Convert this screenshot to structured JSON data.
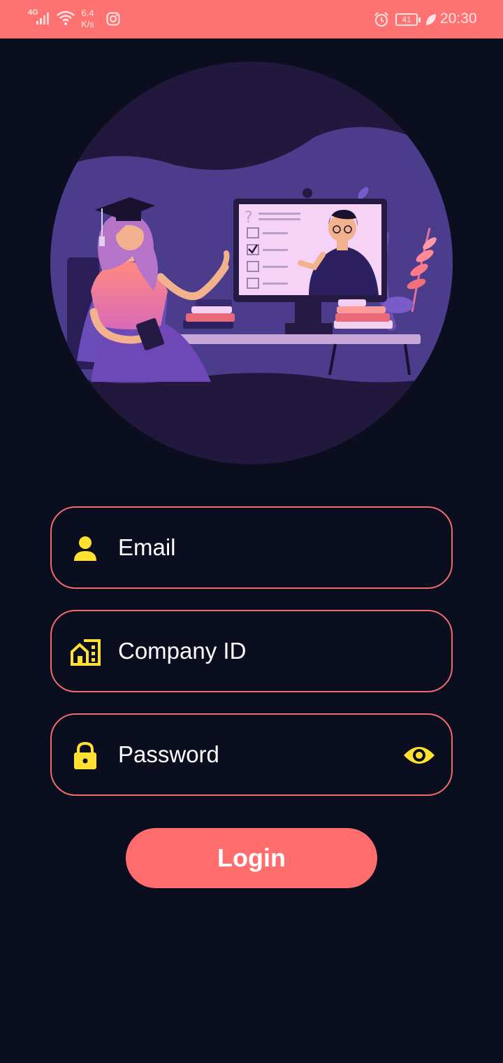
{
  "status_bar": {
    "network": "4G",
    "speed_value": "6.4",
    "speed_unit": "K/s",
    "battery": "41",
    "time": "20:30",
    "icons": [
      "signal-icon",
      "wifi-icon",
      "instagram-icon",
      "alarm-icon",
      "battery-icon",
      "leaf-icon"
    ]
  },
  "illustration": {
    "description_icon": "online-learning-illustration"
  },
  "form": {
    "email_label": "Email",
    "company_label": "Company ID",
    "password_label": "Password",
    "login_label": "Login"
  },
  "colors": {
    "accent": "#ff6d6d",
    "background": "#0a0e1e",
    "icon": "#ffe033",
    "field_border": "#f06c6c"
  }
}
